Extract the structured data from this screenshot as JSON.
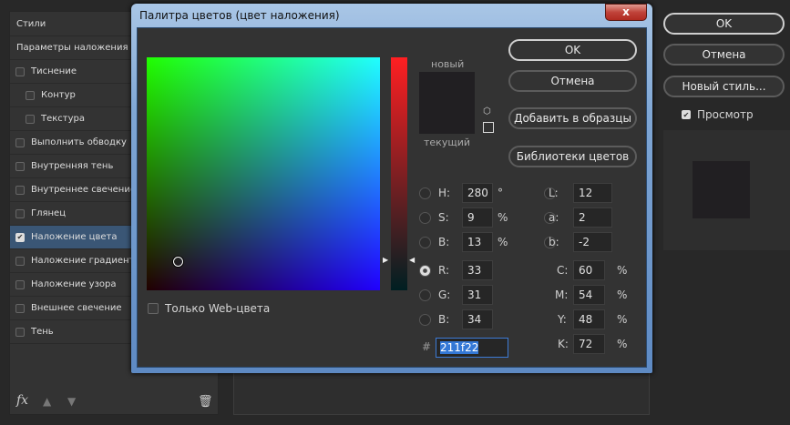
{
  "left_panel": {
    "items": [
      {
        "label": "Стили",
        "checkbox": null
      },
      {
        "label": "Параметры наложения",
        "checkbox": null
      },
      {
        "label": "Тиснение",
        "checkbox": false
      },
      {
        "label": "Контур",
        "checkbox": false,
        "indent": true
      },
      {
        "label": "Текстура",
        "checkbox": false,
        "indent": true
      },
      {
        "label": "Выполнить обводку",
        "checkbox": false
      },
      {
        "label": "Внутренняя тень",
        "checkbox": false
      },
      {
        "label": "Внутреннее свечение",
        "checkbox": false
      },
      {
        "label": "Глянец",
        "checkbox": false
      },
      {
        "label": "Наложение цвета",
        "checkbox": true,
        "selected": true
      },
      {
        "label": "Наложение градиента",
        "checkbox": false
      },
      {
        "label": "Наложение узора",
        "checkbox": false
      },
      {
        "label": "Внешнее свечение",
        "checkbox": false
      },
      {
        "label": "Тень",
        "checkbox": false
      }
    ],
    "fx_label": "fx"
  },
  "dialog": {
    "title": "Палитра цветов (цвет наложения)",
    "close": "x",
    "new_label": "новый",
    "current_label": "текущий",
    "new_color": "#211f22",
    "current_color": "#211f22",
    "ok": "OK",
    "cancel": "Отмена",
    "add_swatch": "Добавить в образцы",
    "libraries": "Библиотеки цветов",
    "web_only": "Только Web-цвета",
    "fields": {
      "H": {
        "label": "H:",
        "value": "280",
        "unit": "°"
      },
      "S": {
        "label": "S:",
        "value": "9",
        "unit": "%"
      },
      "Bv": {
        "label": "B:",
        "value": "13",
        "unit": "%"
      },
      "R": {
        "label": "R:",
        "value": "33"
      },
      "G": {
        "label": "G:",
        "value": "31"
      },
      "B": {
        "label": "B:",
        "value": "34"
      },
      "L": {
        "label": "L:",
        "value": "12"
      },
      "a": {
        "label": "a:",
        "value": "2"
      },
      "b": {
        "label": "b:",
        "value": "-2"
      },
      "C": {
        "label": "C:",
        "value": "60",
        "unit": "%"
      },
      "M": {
        "label": "M:",
        "value": "54",
        "unit": "%"
      },
      "Y": {
        "label": "Y:",
        "value": "48",
        "unit": "%"
      },
      "K": {
        "label": "K:",
        "value": "72",
        "unit": "%"
      }
    },
    "selected_channel": "R",
    "hash": "#",
    "hex": "211f22"
  },
  "right_panel": {
    "ok": "OK",
    "cancel": "Отмена",
    "new_style": "Новый стиль...",
    "preview": "Просмотр",
    "preview_checked": true
  }
}
